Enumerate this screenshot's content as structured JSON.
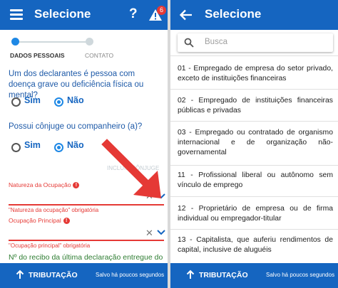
{
  "left": {
    "title": "Selecione",
    "help_glyph": "?",
    "alert_count": "6",
    "steps": [
      "DADOS PESSOAIS",
      "CONTATO"
    ],
    "q1": "Um dos declarantes é pessoa com doença grave ou deficiência física ou mental?",
    "q2": "Possui cônjuge ou companheiro (a)?",
    "yes": "Sim",
    "no": "Não",
    "include_spouse": "INCLUIR CÔNJUGE",
    "field1_label": "Natureza da Ocupação",
    "field1_error": "\"Natureza da ocupação\" obrigatória",
    "field2_label": "Ocupação Principal",
    "field2_error": "\"Ocupação principal\" obrigatória",
    "error_mark": "!",
    "clear_glyph": "✕",
    "cut_text": "Nº do recibo da última declaração entregue do"
  },
  "right": {
    "title": "Selecione",
    "search_placeholder": "Busca",
    "options": [
      "01 - Empregado de empresa do setor privado, exceto de instituições financeiras",
      "02 - Empregado de instituições financeiras públicas e privadas",
      "03 - Empregado ou contratado de organismo internacional e de organização não-governamental",
      "11 - Profissional liberal ou autônomo sem vínculo de emprego",
      "12 - Proprietário de empresa ou de firma individual ou empregador-titular",
      "13 - Capitalista, que auferiu rendimentos de capital, inclusive de aluguéis"
    ]
  },
  "bottom": {
    "tab_label": "TRIBUTAÇÃO",
    "saved_text": "Salvo há poucos segundos"
  },
  "colors": {
    "primary": "#1565c0",
    "accent": "#1e88e5",
    "error": "#e53935",
    "pointer_arrow": "#e53935"
  },
  "icons": [
    "menu-icon",
    "help-icon",
    "alert-icon",
    "back-arrow-icon",
    "search-icon",
    "close-icon",
    "chevron-down-icon",
    "arrow-up-icon"
  ]
}
